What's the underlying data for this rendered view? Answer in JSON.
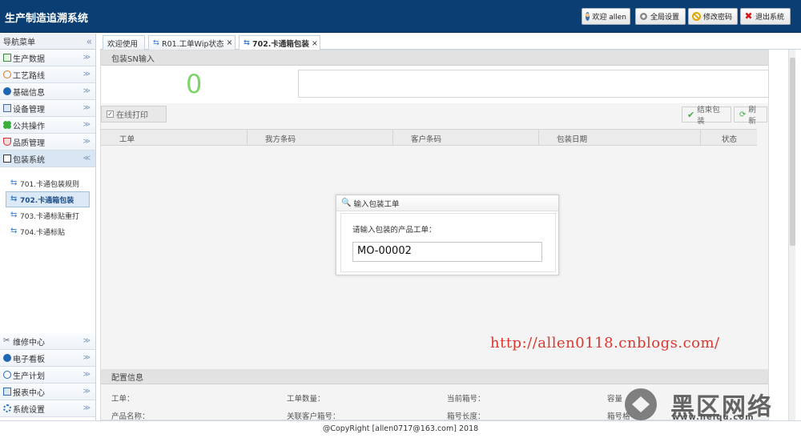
{
  "header": {
    "title": "生产制造追溯系统",
    "buttons": [
      {
        "label": "欢迎 allen",
        "icon": "user-icon"
      },
      {
        "label": "全局设置",
        "icon": "gear-icon"
      },
      {
        "label": "修改密码",
        "icon": "key-icon"
      },
      {
        "label": "退出系统",
        "icon": "close-icon"
      }
    ]
  },
  "sidebar": {
    "title": "导航菜单",
    "collapse_glyph": "«",
    "items": [
      {
        "label": "生产数据"
      },
      {
        "label": "工艺路线"
      },
      {
        "label": "基础信息"
      },
      {
        "label": "设备管理"
      },
      {
        "label": "公共操作"
      },
      {
        "label": "品质管理"
      },
      {
        "label": "包装系统"
      }
    ],
    "subitems": [
      {
        "label": "701.卡通包装规则"
      },
      {
        "label": "702.卡通箱包装"
      },
      {
        "label": "703.卡通标贴重打"
      },
      {
        "label": "704.卡通标贴"
      }
    ],
    "bottom_items": [
      {
        "label": "维修中心"
      },
      {
        "label": "电子看板"
      },
      {
        "label": "生产计划"
      },
      {
        "label": "报表中心"
      },
      {
        "label": "系统设置"
      }
    ]
  },
  "tabs": [
    {
      "label": "欢迎使用"
    },
    {
      "label": "R01.工单Wip状态",
      "close": "×"
    },
    {
      "label": "702.卡通箱包装",
      "close": "×"
    }
  ],
  "sn_panel": {
    "title": "包装SN输入",
    "count": "0"
  },
  "toolbar": {
    "online_print": "在线打印",
    "finish_pack": "结束包装",
    "refresh": "刷新"
  },
  "grid": {
    "columns": [
      "工单",
      "我方条码",
      "客户条码",
      "包装日期",
      "状态"
    ]
  },
  "dialog": {
    "title": "输入包装工单",
    "prompt": "请输入包装的产品工单：",
    "value": "MO-00002"
  },
  "watermark": "http://allen0118.cnblogs.com/",
  "config": {
    "title": "配置信息",
    "row1": [
      "工单：",
      "工单数量：",
      "当前箱号：",
      "容量"
    ],
    "row2": [
      "产品名称：",
      "关联客户箱号：",
      "箱号长度：",
      "箱号格"
    ]
  },
  "footer": "@CopyRight [allen0717@163.com] 2018",
  "site_logo": {
    "text": "黑区网络",
    "url": "www.heiqu.com"
  },
  "colors": {
    "header": "#0b3f73",
    "count": "#7ed36b",
    "watermark": "#d9382f"
  }
}
